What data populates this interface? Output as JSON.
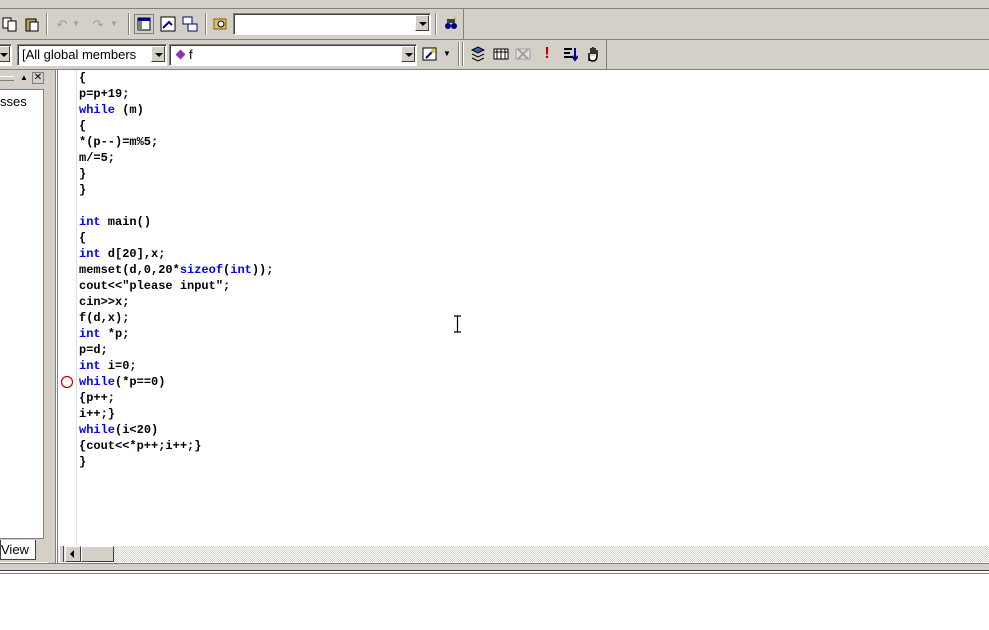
{
  "toolbar2": {
    "classes_combo": "[All global members",
    "members_combo": "f",
    "find_combo_value": ""
  },
  "class_view": {
    "partial_label": "sses",
    "tab_label": "View"
  },
  "editor": {
    "lines": [
      "{",
      "p=p+19;",
      "while (m)",
      "{",
      "*(p--)=m%5;",
      "m/=5;",
      "}",
      "}",
      "",
      "int main()",
      "{",
      "int d[20],x;",
      "memset(d,0,20*sizeof(int));",
      "cout<<\"please input\";",
      "cin>>x;",
      "f(d,x);",
      "int *p;",
      "p=d;",
      "int i=0;",
      "while(*p==0)",
      "{p++;",
      "i++;}",
      "while(i<20)",
      "{cout<<*p++;i++;}",
      "}"
    ],
    "breakpoint_line": 19
  },
  "icons": [
    "copy-icon",
    "paste-icon",
    "undo-icon",
    "redo-icon",
    "workspace-icon",
    "output-icon",
    "window-list-icon",
    "find-in-files-icon",
    "find-icon",
    "compile-icon",
    "build-icon",
    "stop-build-icon",
    "execute-icon",
    "go-icon",
    "breakpoint-hand-icon",
    "wizard-icon"
  ]
}
